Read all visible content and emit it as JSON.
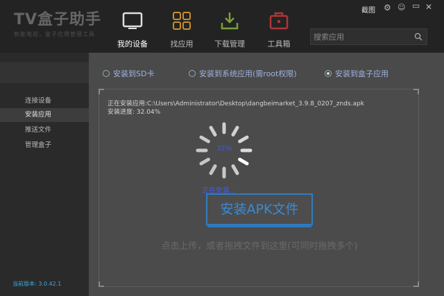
{
  "app": {
    "logo_name": "TV盒子助手",
    "logo_slogan": "智能电视，盒子应用管理工具"
  },
  "nav": [
    {
      "label": "我的设备",
      "icon": "tv-icon",
      "active": true
    },
    {
      "label": "找应用",
      "icon": "apps-grid-icon",
      "active": false
    },
    {
      "label": "下载管理",
      "icon": "download-icon",
      "active": false
    },
    {
      "label": "工具箱",
      "icon": "toolbox-icon",
      "active": false
    }
  ],
  "search": {
    "placeholder": "搜索应用"
  },
  "window_controls": {
    "screenshot_label": "截图"
  },
  "sidebar": {
    "items": [
      {
        "label": "连接设备",
        "active": false
      },
      {
        "label": "安装应用",
        "active": true
      },
      {
        "label": "推送文件",
        "active": false
      },
      {
        "label": "管理盒子",
        "active": false
      }
    ],
    "version": "当前版本: 3.0.42.1"
  },
  "install_options": [
    {
      "label": "安装到SD卡",
      "checked": false
    },
    {
      "label": "安装到系统应用(需root权限)",
      "checked": false
    },
    {
      "label": "安装到盒子应用",
      "checked": true
    }
  ],
  "progress": {
    "installing_app_line": "正在安装应用:C:\\Users\\Administrator\\Desktop\\dangbeimarket_3.9.8_0207_znds.apk",
    "progress_line": "安装进度:  32.04%",
    "percent_label": "32%",
    "status_text": "正在安装..."
  },
  "upload": {
    "button_label": "安装APK文件",
    "hint": "点击上传，或者拖拽文件到这里(可同时拖拽多个)"
  },
  "colors": {
    "accent_blue": "#3b8bd6",
    "version_blue": "#3cabe0",
    "install_text_blue": "#3d5cff"
  }
}
